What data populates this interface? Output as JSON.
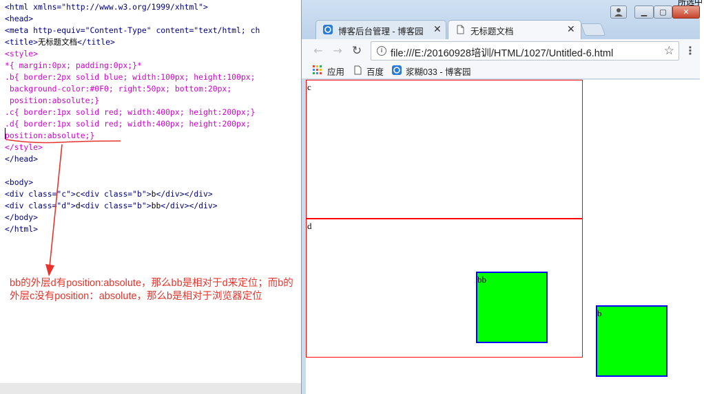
{
  "editor": {
    "lines": [
      {
        "segments": [
          {
            "t": "<html xmlns=\"http://www.w3.org/1999/xhtml\">",
            "c": "blue"
          }
        ]
      },
      {
        "segments": [
          {
            "t": "<head>",
            "c": "blue"
          }
        ]
      },
      {
        "segments": [
          {
            "t": "<meta http-equiv=\"Content-Type\" content=\"text/html; ch",
            "c": "blue"
          }
        ]
      },
      {
        "segments": [
          {
            "t": "<title>",
            "c": "blue"
          },
          {
            "t": "无标题文档",
            "c": "black"
          },
          {
            "t": "</title>",
            "c": "blue"
          }
        ]
      },
      {
        "segments": [
          {
            "t": "<style>",
            "c": "magenta"
          }
        ]
      },
      {
        "segments": [
          {
            "t": "*{ margin:0px; padding:0px;}*",
            "c": "magenta"
          }
        ]
      },
      {
        "segments": [
          {
            "t": ".b{ border:2px solid blue; width:100px; height:100px;",
            "c": "magenta"
          }
        ]
      },
      {
        "segments": [
          {
            "t": " background-color:#0F0; right:50px; bottom:20px;",
            "c": "magenta"
          }
        ]
      },
      {
        "segments": [
          {
            "t": " position:absolute;}",
            "c": "magenta"
          }
        ]
      },
      {
        "segments": [
          {
            "t": ".c{ border:1px solid red; width:400px; height:200px;}",
            "c": "magenta"
          }
        ]
      },
      {
        "segments": [
          {
            "t": ".d{ border:1px solid red; width:400px; height:200px;",
            "c": "magenta"
          }
        ]
      },
      {
        "segments": [
          {
            "t": "position:absolute;}",
            "c": "magenta"
          }
        ]
      },
      {
        "segments": [
          {
            "t": "</style>",
            "c": "magenta"
          }
        ]
      },
      {
        "segments": [
          {
            "t": "</head>",
            "c": "blue"
          }
        ]
      },
      {
        "segments": [
          {
            "t": "",
            "c": "blue"
          }
        ]
      },
      {
        "segments": [
          {
            "t": "<body>",
            "c": "blue"
          }
        ]
      },
      {
        "segments": [
          {
            "t": "<div class=\"c\">",
            "c": "blue"
          },
          {
            "t": "c",
            "c": "black"
          },
          {
            "t": "<div class=\"b\">",
            "c": "blue"
          },
          {
            "t": "b",
            "c": "black"
          },
          {
            "t": "</div></div>",
            "c": "blue"
          }
        ]
      },
      {
        "segments": [
          {
            "t": "<div class=\"d\">",
            "c": "blue"
          },
          {
            "t": "d",
            "c": "black"
          },
          {
            "t": "<div class=\"b\">",
            "c": "blue"
          },
          {
            "t": "bb",
            "c": "black"
          },
          {
            "t": "</div></div>",
            "c": "blue"
          }
        ]
      },
      {
        "segments": [
          {
            "t": "</body>",
            "c": "blue"
          }
        ]
      },
      {
        "segments": [
          {
            "t": "</html>",
            "c": "blue"
          }
        ]
      }
    ]
  },
  "annotation": {
    "text": "bb的外层d有position:absolute，那么bb是相对于d来定位；而b的外层c没有position：absolute，那么b是相对于浏览器定位"
  },
  "corner_text": "所选中",
  "browser": {
    "tabs": [
      {
        "title": "博客后台管理 - 博客园",
        "icon": "cnblogs-icon"
      },
      {
        "title": "无标题文档",
        "icon": "document-icon"
      }
    ],
    "address": "file:///E:/20160928培训/HTML/1027/Untitled-6.html",
    "bookmarks": [
      {
        "label": "应用"
      },
      {
        "label": "百度"
      },
      {
        "label": "浆糊033 - 博客园"
      }
    ]
  },
  "demo": {
    "c_label": "c",
    "d_label": "d",
    "b_label": "b",
    "bb_label": "bb"
  },
  "colors": {
    "red_border": "#ff0000",
    "blue_border": "#0000ff",
    "green_fill": "#00ff00",
    "annotation_red": "#e8332b"
  }
}
